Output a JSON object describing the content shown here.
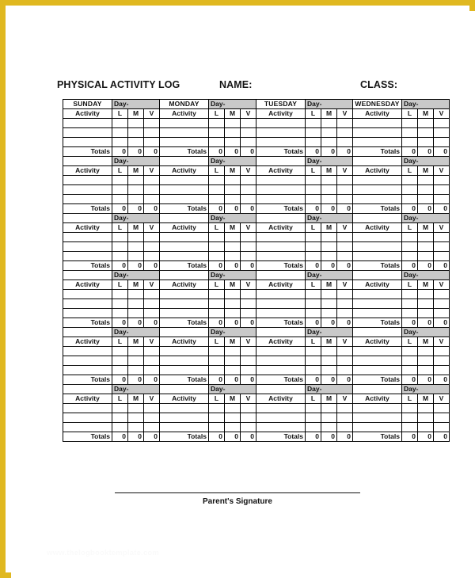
{
  "page": {
    "border_color": "#e0b820",
    "background": "#ffffff"
  },
  "header": {
    "title": "PHYSICAL ACTIVITY LOG",
    "name_label": "NAME:",
    "class_label": "CLASS:"
  },
  "table": {
    "days": [
      "SUNDAY",
      "MONDAY",
      "TUESDAY",
      "WEDNESDAY"
    ],
    "day_number_label": "Day-",
    "shade_color": "#c9c9c9",
    "columns": {
      "activity": "Activity",
      "light": "L",
      "moderate": "M",
      "vigorous": "V"
    },
    "totals_label": "Totals",
    "totals_values": [
      "0",
      "0",
      "0"
    ],
    "blank_rows_per_block": 3,
    "blocks": 6
  },
  "footer": {
    "signature_label": "Parent's Signature",
    "watermark": "www.thelogbooktemplate.com"
  }
}
